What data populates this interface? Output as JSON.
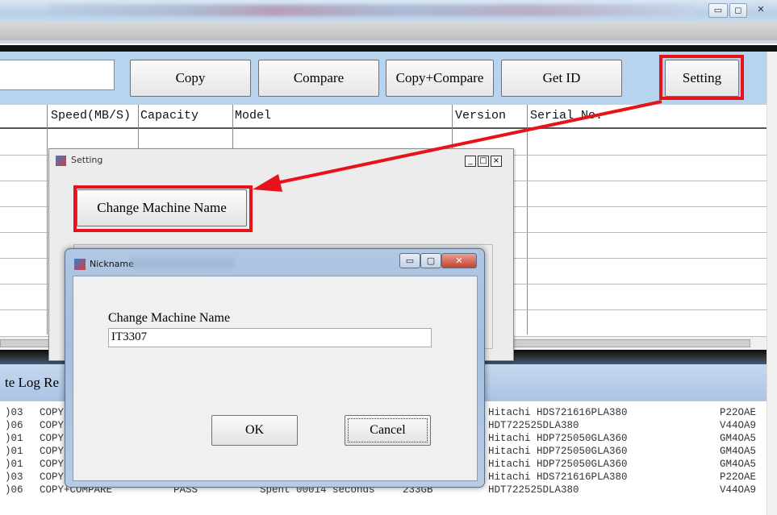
{
  "window": {
    "min_label": "▭",
    "max_label": "◻",
    "close_label": "✕"
  },
  "toolbar": {
    "buttons": [
      {
        "label": "Copy"
      },
      {
        "label": "Compare"
      },
      {
        "label": "Copy+Compare"
      },
      {
        "label": "Get ID"
      },
      {
        "label": "Setting"
      }
    ]
  },
  "grid": {
    "headers": [
      "Speed(MB/S)",
      "Capacity",
      "Model",
      "Version",
      "Serial No."
    ]
  },
  "log": {
    "title": "te Log Re",
    "rows": [
      {
        "id": ")03",
        "op": "COPY",
        "model": "Hitachi HDS721616PLA380",
        "serial": "P22OAE"
      },
      {
        "id": ")06",
        "op": "COPY",
        "model": "HDT722525DLA380",
        "serial": "V44OA9"
      },
      {
        "id": ")01",
        "op": "COPY",
        "model": "Hitachi HDP725050GLA360",
        "serial": "GM4OA5"
      },
      {
        "id": ")01",
        "op": "COPY",
        "model": "Hitachi HDP725050GLA360",
        "serial": "GM4OA5"
      },
      {
        "id": ")01",
        "op": "COPY",
        "model": "Hitachi HDP725050GLA360",
        "serial": "GM4OA5"
      },
      {
        "id": ")03",
        "op": "COPY",
        "model": "Hitachi HDS721616PLA380",
        "serial": "P22OAE"
      },
      {
        "id": ")06",
        "op": "COPY+COMPARE",
        "result": "PASS",
        "time": "Spent 00014 seconds",
        "size": "233GB",
        "model": "HDT722525DLA380",
        "serial": "V44OA9"
      }
    ]
  },
  "setting_dialog": {
    "title": "Setting",
    "controls": {
      "min": "_",
      "max": "□",
      "close": "×"
    },
    "change_name_button": "Change Machine Name"
  },
  "nickname_dialog": {
    "title": "Nickname",
    "controls": {
      "min": "▭",
      "max": "▢",
      "close": "✕"
    },
    "label": "Change Machine Name",
    "input_value": "IT3307",
    "ok_label": "OK",
    "cancel_label": "Cancel"
  },
  "colors": {
    "highlight": "#e8121a",
    "toolbar_bg": "#b8d3ee"
  }
}
